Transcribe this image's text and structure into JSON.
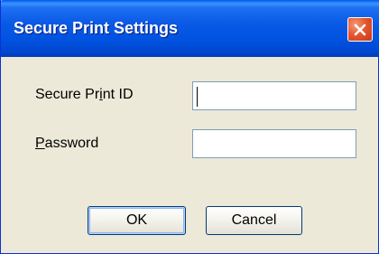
{
  "window": {
    "title": "Secure Print Settings",
    "close_icon": "close-icon"
  },
  "form": {
    "secure_print_id": {
      "label_before": "Secure Pr",
      "label_mnemonic": "i",
      "label_after": "nt ID",
      "value": ""
    },
    "password": {
      "label_mnemonic": "P",
      "label_after": "assword",
      "value": ""
    }
  },
  "buttons": {
    "ok_label": "OK",
    "cancel_label": "Cancel"
  },
  "colors": {
    "titlebar": "#0054e3",
    "dialog_bg": "#ece9d8",
    "close_button": "#e4572f",
    "input_border": "#7f9db9"
  }
}
